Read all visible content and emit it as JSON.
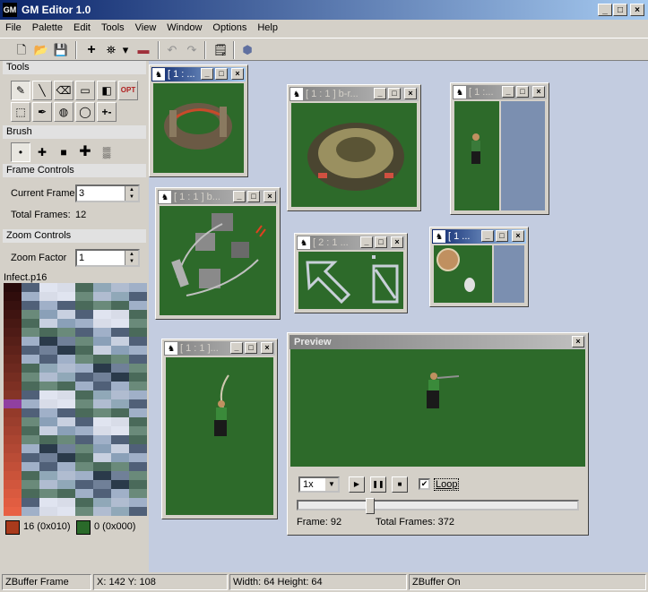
{
  "app": {
    "title": "GM Editor 1.0",
    "icon": "app-icon"
  },
  "window_controls": {
    "minimize": "_",
    "maximize": "□",
    "close": "×"
  },
  "menu": [
    "File",
    "Palette",
    "Edit",
    "Tools",
    "View",
    "Window",
    "Options",
    "Help"
  ],
  "toolbar": {
    "buttons": [
      {
        "name": "new-icon",
        "glyph": "🗋"
      },
      {
        "name": "open-icon",
        "glyph": "📂"
      },
      {
        "name": "save-icon",
        "glyph": "💾"
      },
      {
        "name": "add-icon",
        "glyph": "+"
      },
      {
        "name": "grid-icon",
        "glyph": "⛯"
      },
      {
        "name": "dropdown-arrow-icon",
        "glyph": "▾"
      },
      {
        "name": "palette-swatch-icon",
        "glyph": "▬"
      },
      {
        "name": "undo-icon",
        "glyph": "↶"
      },
      {
        "name": "redo-icon",
        "glyph": "↷"
      },
      {
        "name": "properties-icon",
        "glyph": "🗒"
      },
      {
        "name": "shape-icon",
        "glyph": "⬢"
      }
    ]
  },
  "panels": {
    "tools": {
      "title": "Tools",
      "row1": [
        "✎",
        "╲",
        "⌫",
        "▭",
        "◧",
        "OPT"
      ],
      "row2": [
        "⬚",
        "✒",
        "◍",
        "◯",
        "+-"
      ]
    },
    "brush": {
      "title": "Brush",
      "sizes": [
        "•",
        "✚",
        "■",
        "✚",
        "▒"
      ]
    },
    "frame_controls": {
      "title": "Frame Controls",
      "current_frame_label": "Current Frame",
      "current_frame_value": "3",
      "total_frames_label": "Total Frames:",
      "total_frames_value": "12"
    },
    "zoom_controls": {
      "title": "Zoom Controls",
      "zoom_factor_label": "Zoom Factor",
      "zoom_factor_value": "1"
    },
    "palette": {
      "title": "Infect.p16",
      "primary": {
        "label": "16 (0x010)",
        "color": "#a93a1c"
      },
      "secondary": {
        "label": "0 (0x000)",
        "color": "#2a6a2a"
      }
    }
  },
  "mdi_windows": [
    {
      "title": "[ 1 : ...",
      "active": true
    },
    {
      "title": "[ 1 : 1 ] b-r..."
    },
    {
      "title": "[ 1 :..."
    },
    {
      "title": "[ 1 : 1 ] b..."
    },
    {
      "title": "[ 2 : 1 ..."
    },
    {
      "title": "[ 1 ..."
    },
    {
      "title": "[ 1 : 1 ]..."
    }
  ],
  "preview": {
    "title": "Preview",
    "speed": "1x",
    "loop_label": "Loop",
    "loop_checked": "✔",
    "frame_label": "Frame: 92",
    "total_label": "Total Frames: 372",
    "position": 0.25
  },
  "status": {
    "mode": "ZBuffer Frame",
    "coords": "X: 142 Y: 108",
    "size": "Width: 64 Height: 64",
    "zbuffer": "ZBuffer On"
  },
  "colors": {
    "titlebar_start": "#0a246a",
    "titlebar_end": "#a6caf0",
    "canvas_green": "#2d6a2a",
    "mdi_background": "#c3cce0"
  }
}
